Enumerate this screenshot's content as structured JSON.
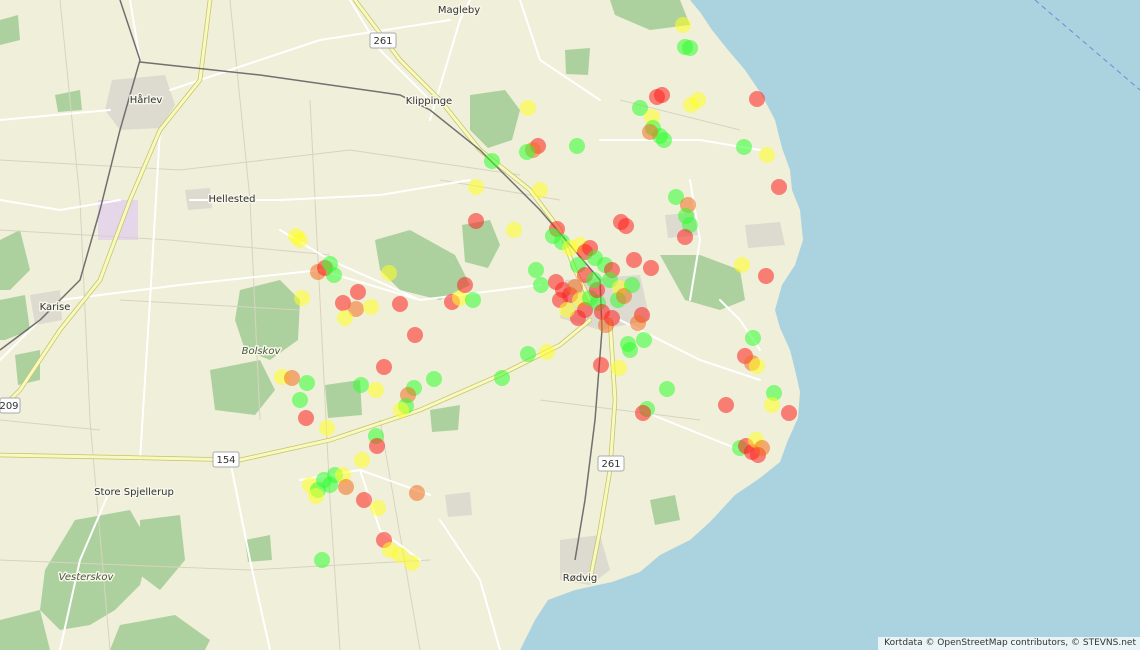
{
  "map": {
    "places": [
      {
        "id": "magleby",
        "label": "Magleby"
      },
      {
        "id": "harlev",
        "label": "Hårlev"
      },
      {
        "id": "klippinge",
        "label": "Klippinge"
      },
      {
        "id": "hellested",
        "label": "Hellested"
      },
      {
        "id": "karise",
        "label": "Karise"
      },
      {
        "id": "bolskov",
        "label": "Bolskov"
      },
      {
        "id": "store_spjellerup",
        "label": "Store Spjellerup"
      },
      {
        "id": "vesterskov",
        "label": "Vesterskov"
      },
      {
        "id": "rodvig",
        "label": "Rødvig"
      }
    ],
    "roads": [
      {
        "id": "r261_north",
        "label": "261"
      },
      {
        "id": "r154",
        "label": "154"
      },
      {
        "id": "r209",
        "label": "209"
      },
      {
        "id": "r261_south",
        "label": "261"
      }
    ],
    "marker_colors": {
      "red": "#ff2020",
      "orange": "#f07020",
      "yellow": "#ffff20",
      "green": "#30ff30"
    }
  },
  "attribution": "Kortdata © OpenStreetMap contributors, © STEVNS.net"
}
